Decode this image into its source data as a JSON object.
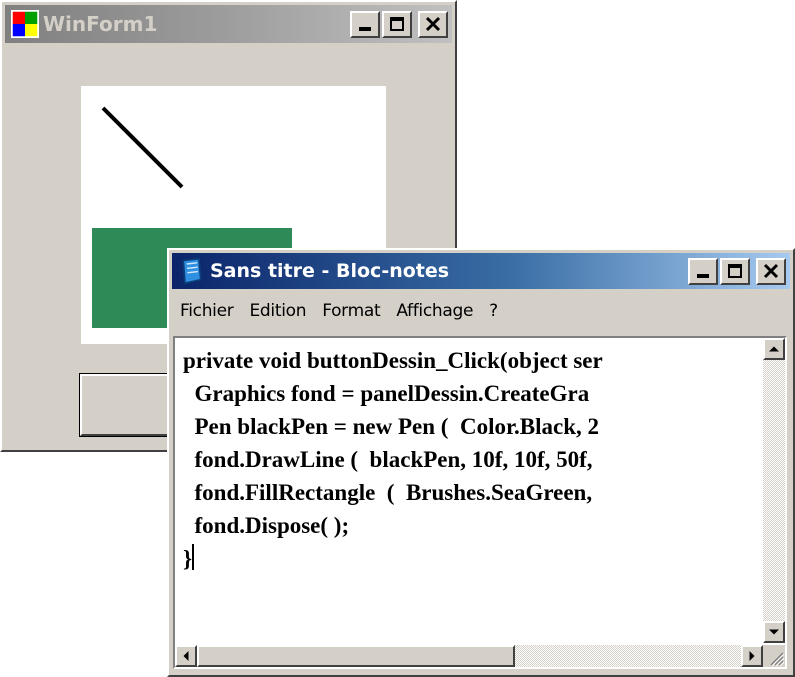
{
  "winform": {
    "title": "WinForm1",
    "icon": "winform-app-icon",
    "controls": [
      "minimize-icon",
      "maximize-icon",
      "close-icon"
    ]
  },
  "drawing": {
    "line_color": "#000000",
    "rect_color": "#2e8b57"
  },
  "notepad": {
    "title": "Sans titre - Bloc-notes",
    "icon": "notepad-icon",
    "menu": [
      "Fichier",
      "Edition",
      "Format",
      "Affichage",
      "?"
    ],
    "code_lines": [
      "private void buttonDessin_Click(object ser",
      "  Graphics fond = panelDessin.CreateGra",
      "  Pen blackPen = new Pen (  Color.Black, 2",
      "  fond.DrawLine (  blackPen, 10f, 10f, 50f,",
      "  fond.FillRectangle  (  Brushes.SeaGreen,",
      "  fond.Dispose( );",
      "}"
    ]
  },
  "colors": {
    "face": "#d4d0c8",
    "active_title": "#0a246a",
    "inactive_title": "#808080",
    "seagreen": "#2e8b57"
  }
}
